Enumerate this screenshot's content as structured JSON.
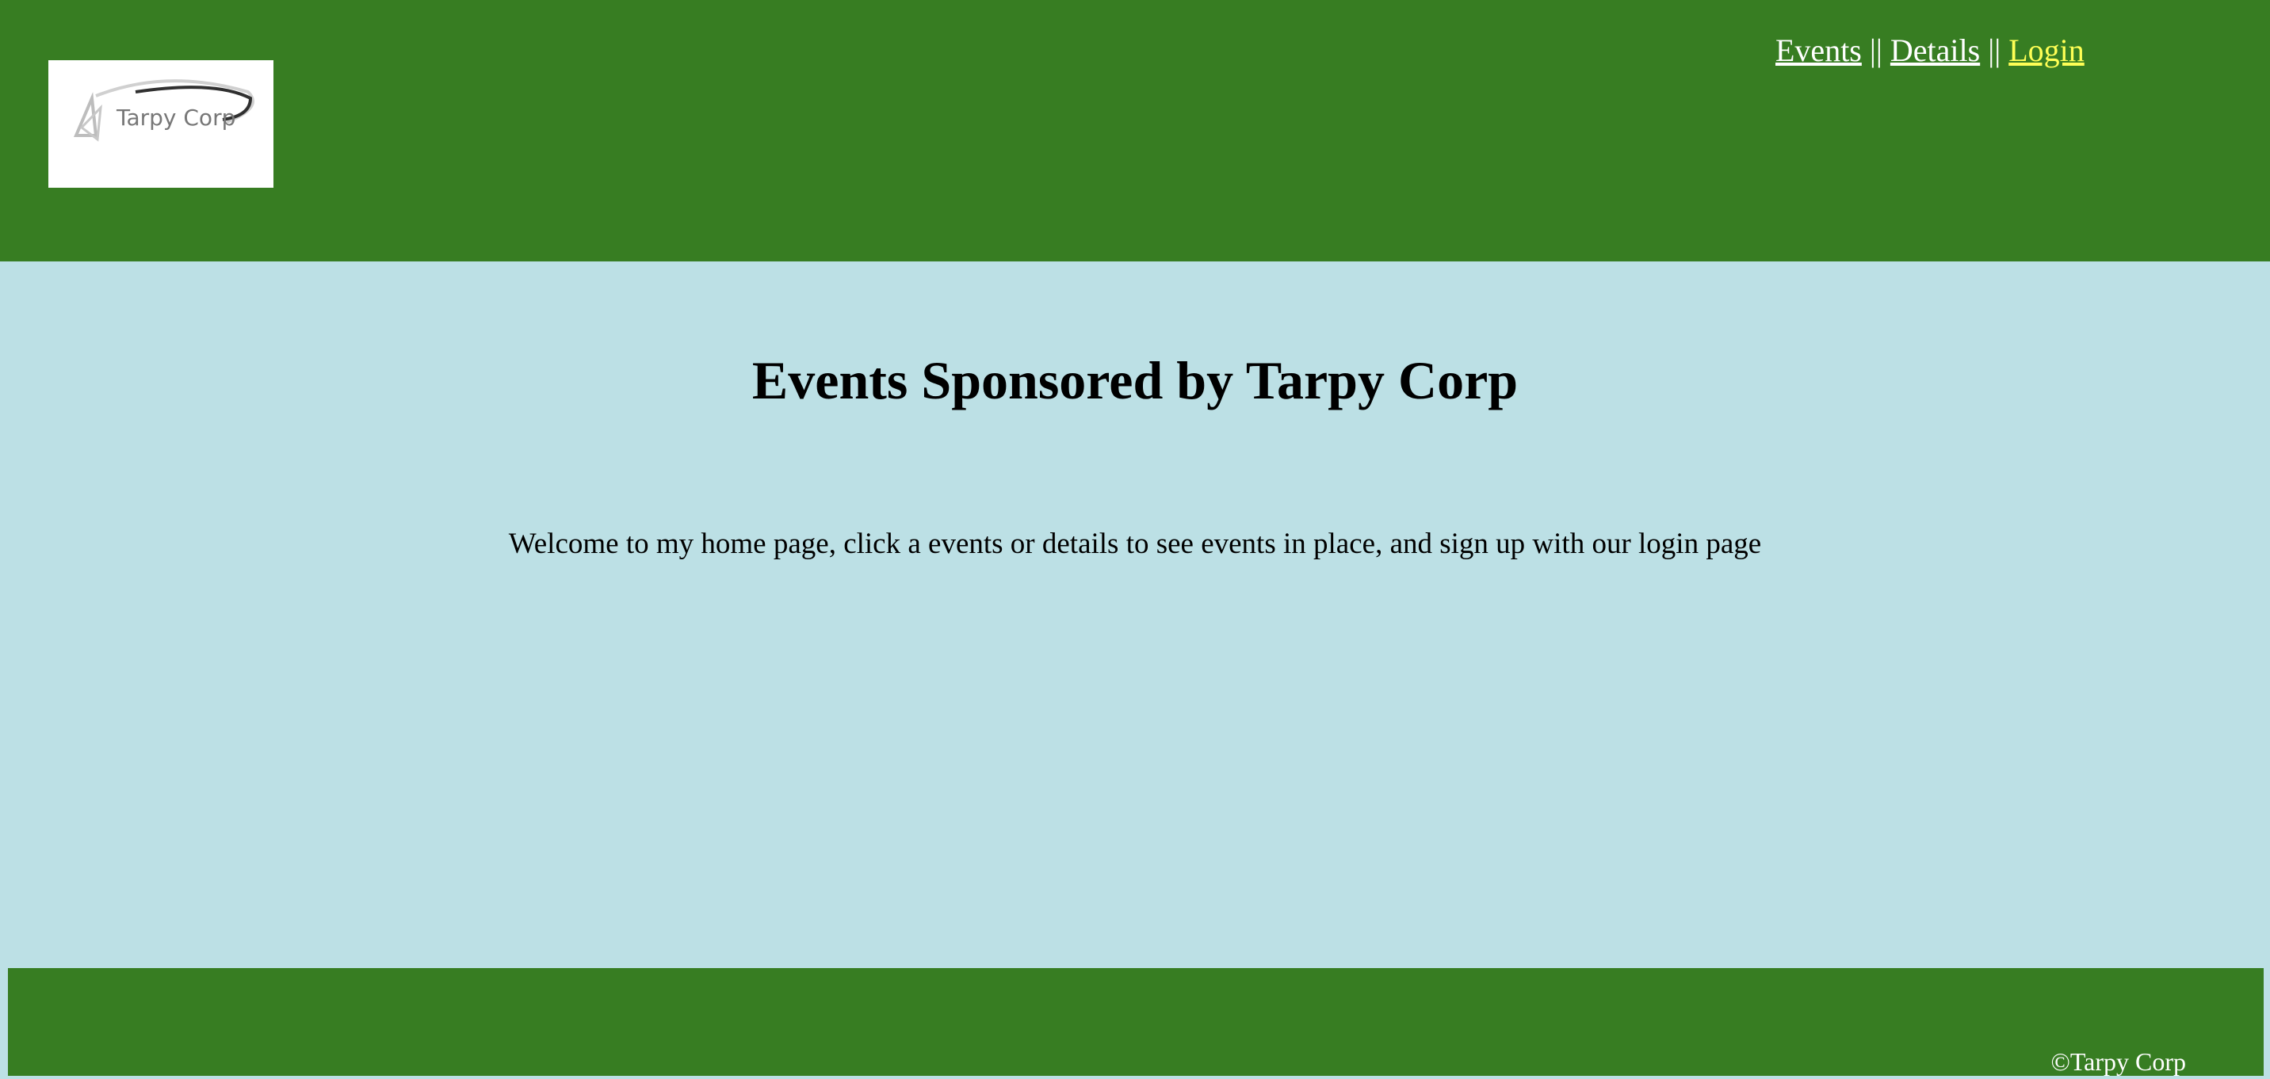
{
  "header": {
    "logo": {
      "text": "Tarpy Corp",
      "icon": "tarpy-corp-logo-icon"
    },
    "nav": {
      "events_label": "Events",
      "separator_1": " || ",
      "details_label": "Details",
      "separator_2": " || ",
      "login_label": "Login"
    }
  },
  "main": {
    "title": "Events Sponsored by Tarpy Corp",
    "welcome_text": "Welcome to my home page, click a events or details to see events in place, and sign up with our login page"
  },
  "footer": {
    "copyright": "©Tarpy Corp"
  },
  "colors": {
    "header_bg": "#377d22",
    "page_bg": "#bce0e5",
    "footer_bg": "#377d22",
    "nav_link": "#ffffff",
    "nav_active_link": "#ffff55"
  }
}
